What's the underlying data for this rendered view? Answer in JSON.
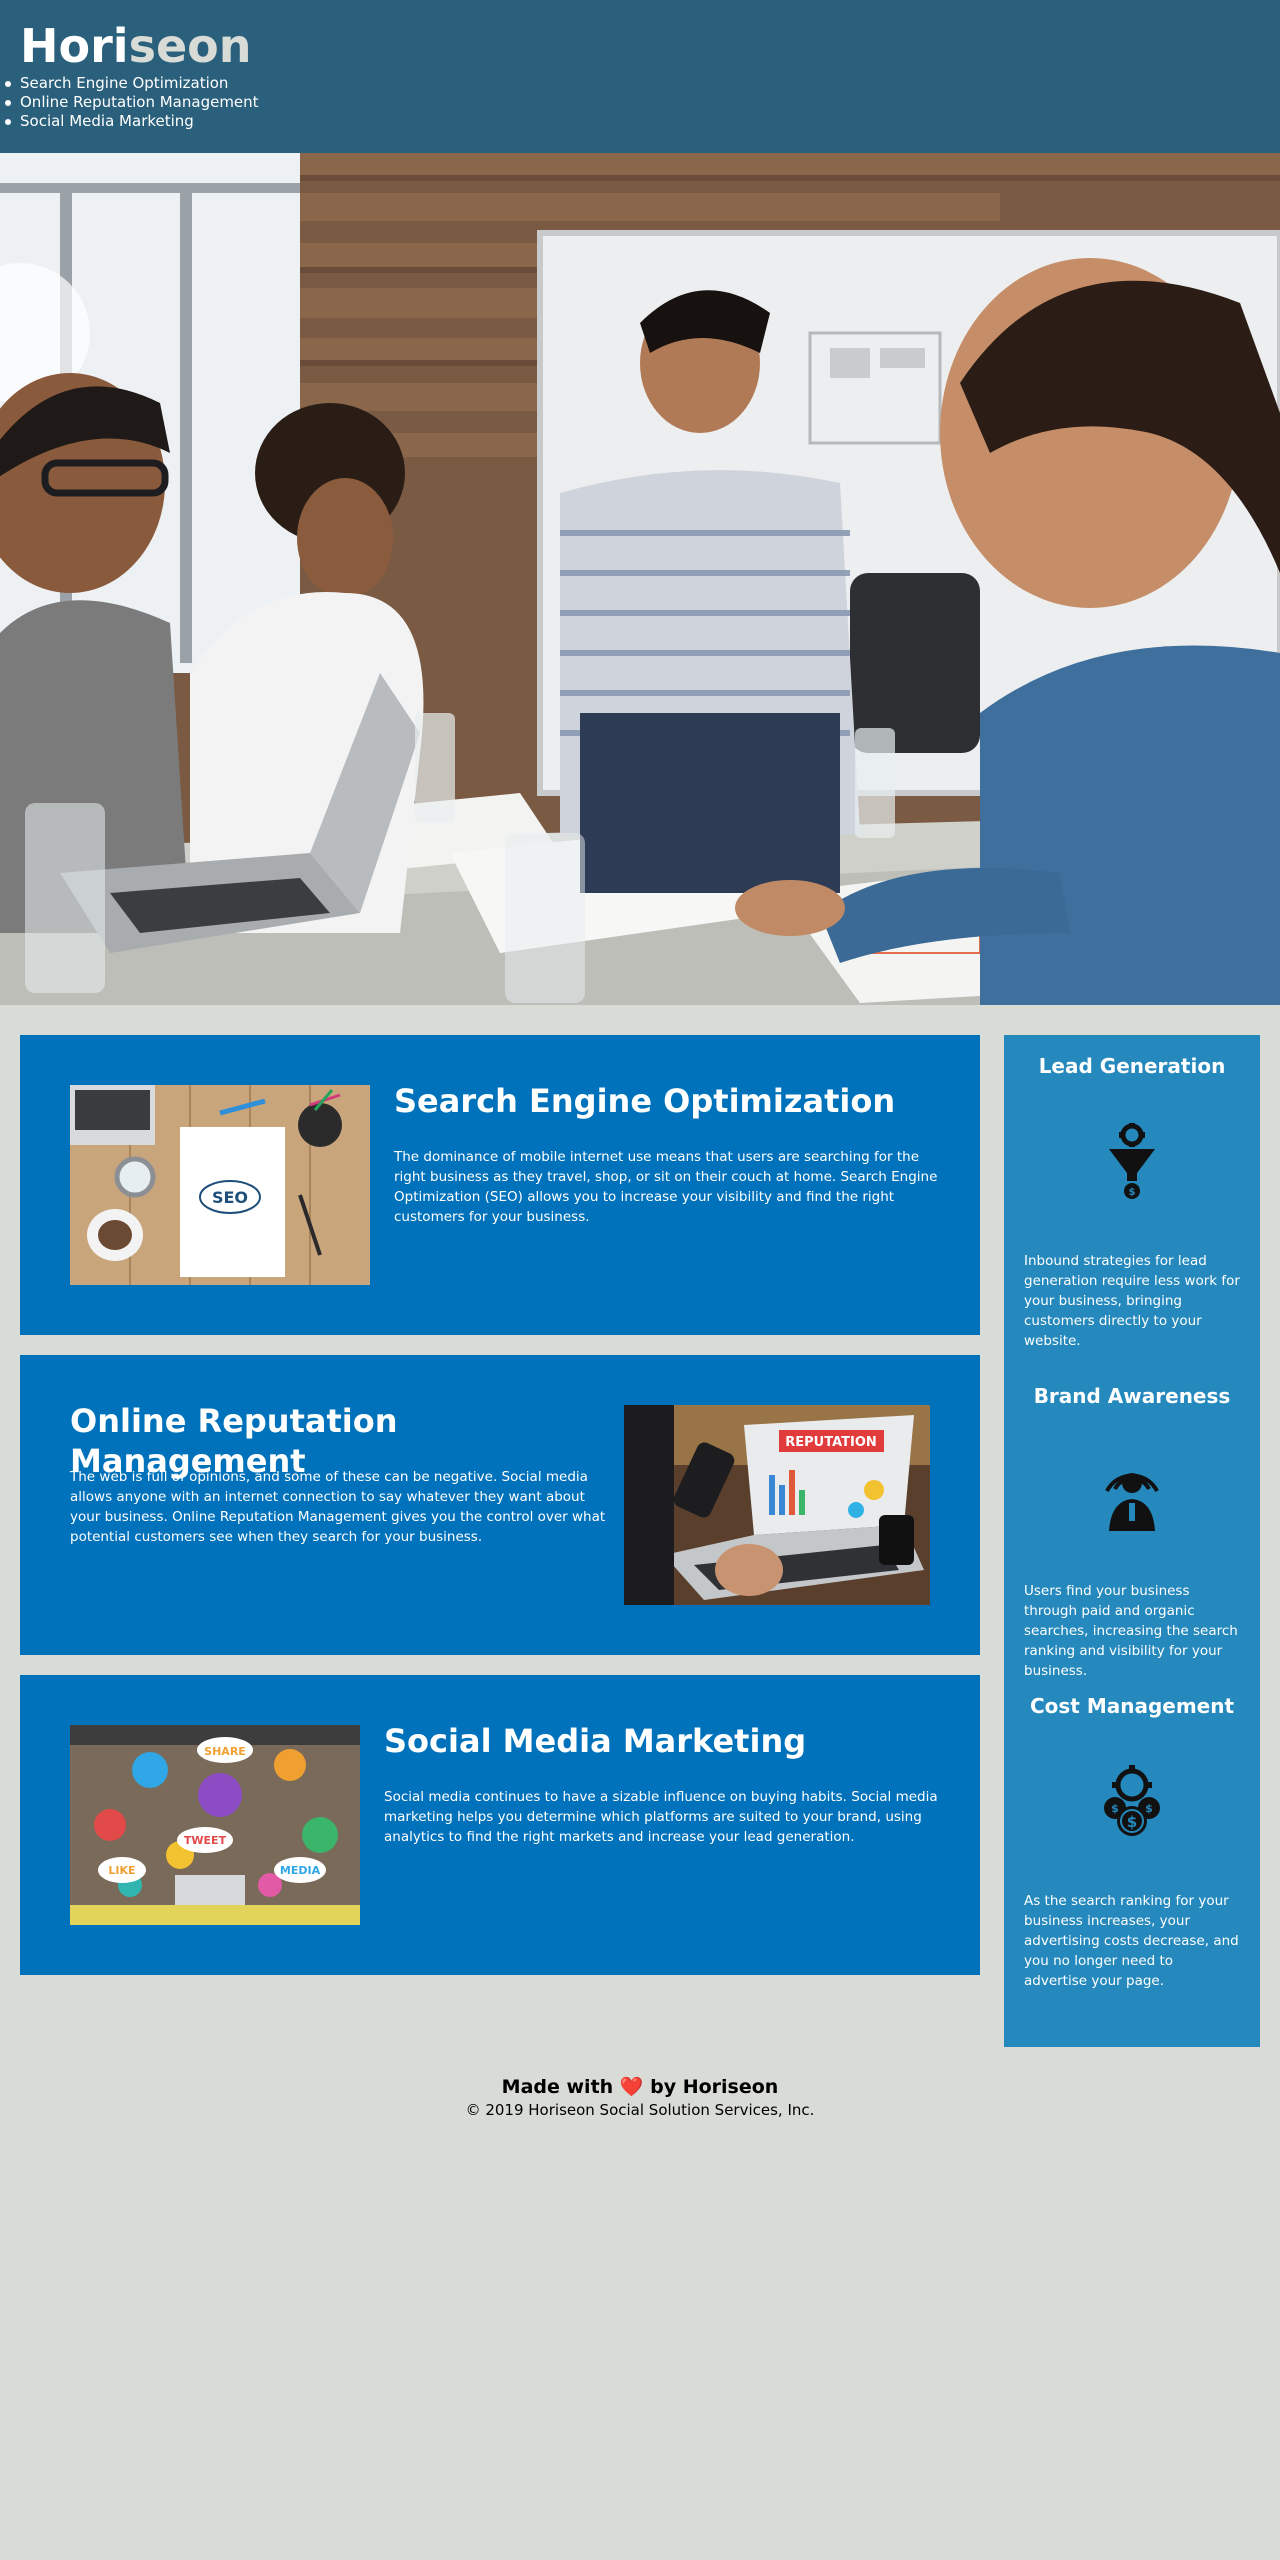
{
  "header": {
    "logo_main": "Hori",
    "logo_accent": "seon",
    "nav": [
      "Search Engine Optimization",
      "Online Reputation Management",
      "Social Media Marketing"
    ]
  },
  "content": [
    {
      "title": "Search Engine Optimization",
      "text": "The dominance of mobile internet use means that users are searching for the right business as they travel, shop, or sit on their couch at home. Search Engine Optimization (SEO) allows you to increase your visibility and find the right customers for your business.",
      "image_label": "SEO"
    },
    {
      "title": "Online Reputation Management",
      "text": "The web is full of opinions, and some of these can be negative. Social media allows anyone with an internet connection to say whatever they want about your business. Online Reputation Management gives you the control over what potential customers see when they search for your business.",
      "image_label": "REPUTATION"
    },
    {
      "title": "Social Media Marketing",
      "text": "Social media continues to have a sizable influence on buying habits. Social media marketing helps you determine which platforms are suited to your brand, using analytics to find the right markets and increase your lead generation.",
      "image_labels": [
        "SHARE",
        "TWEET",
        "LIKE",
        "MEDIA"
      ]
    }
  ],
  "sidebar": [
    {
      "title": "Lead Generation",
      "icon": "funnel-dollar-icon",
      "text": "Inbound strategies for lead generation require less work for your business, bringing customers directly to your website."
    },
    {
      "title": "Brand Awareness",
      "icon": "broadcast-person-icon",
      "text": "Users find your business through paid and organic searches, increasing the search ranking and visibility for your business."
    },
    {
      "title": "Cost Management",
      "icon": "gear-coins-icon",
      "text": "As the search ranking for your business increases, your advertising costs decrease, and you no longer need to advertise your page."
    }
  ],
  "footer": {
    "made_prefix": "Made with",
    "made_suffix": "by Horiseon",
    "heart": "❤️",
    "copyright": "© 2019 Horiseon Social Solution Services, Inc."
  },
  "colors": {
    "header_bg": "#2a607c",
    "card_bg": "#0072bb",
    "sidebar_bg": "#2589bd",
    "page_bg": "#d9dcd6",
    "logo_accent": "#d9dcd6"
  }
}
